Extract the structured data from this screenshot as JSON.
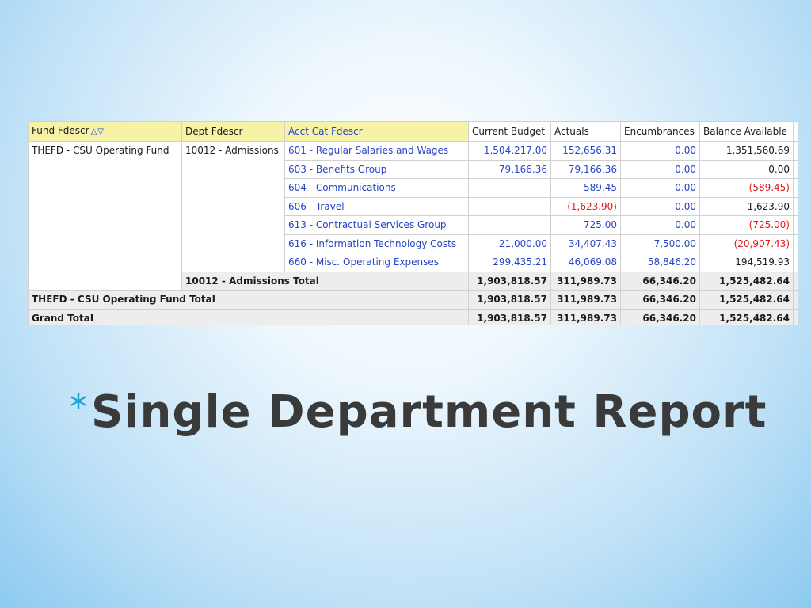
{
  "headers": {
    "fund": "Fund Fdescr",
    "dept": "Dept Fdescr",
    "acct": "Acct Cat Fdescr",
    "budget": "Current Budget",
    "actuals": "Actuals",
    "enc": "Encumbrances",
    "bal": "Balance Available"
  },
  "sort_icons": [
    "sort-ascending-icon",
    "sort-descending-icon"
  ],
  "fund_name": "THEFD - CSU Operating Fund",
  "dept_name": "10012 - Admissions",
  "rows": [
    {
      "acct": "601 - Regular Salaries and Wages",
      "budget": "1,504,217.00",
      "actuals": "152,656.31",
      "enc": "0.00",
      "bal": "1,351,560.69"
    },
    {
      "acct": "603 - Benefits Group",
      "budget": "79,166.36",
      "actuals": "79,166.36",
      "enc": "0.00",
      "bal": "0.00"
    },
    {
      "acct": "604 - Communications",
      "budget": "",
      "actuals": "589.45",
      "enc": "0.00",
      "bal": "(589.45)"
    },
    {
      "acct": "606 - Travel",
      "budget": "",
      "actuals": "(1,623.90)",
      "enc": "0.00",
      "bal": "1,623.90"
    },
    {
      "acct": "613 - Contractual Services Group",
      "budget": "",
      "actuals": "725.00",
      "enc": "0.00",
      "bal": "(725.00)"
    },
    {
      "acct": "616 - Information Technology Costs",
      "budget": "21,000.00",
      "actuals": "34,407.43",
      "enc": "7,500.00",
      "bal": "(20,907.43)"
    },
    {
      "acct": "660 - Misc. Operating Expenses",
      "budget": "299,435.21",
      "actuals": "46,069.08",
      "enc": "58,846.20",
      "bal": "194,519.93"
    }
  ],
  "dept_total": {
    "label": "10012 - Admissions Total",
    "budget": "1,903,818.57",
    "actuals": "311,989.73",
    "enc": "66,346.20",
    "bal": "1,525,482.64"
  },
  "fund_total": {
    "label": "THEFD - CSU Operating Fund Total",
    "budget": "1,903,818.57",
    "actuals": "311,989.73",
    "enc": "66,346.20",
    "bal": "1,525,482.64"
  },
  "grand_total": {
    "label": "Grand Total",
    "budget": "1,903,818.57",
    "actuals": "311,989.73",
    "enc": "66,346.20",
    "bal": "1,525,482.64"
  },
  "slide": {
    "bullet": "*",
    "title": "Single Department Report"
  },
  "colors": {
    "header_yellow": "#f7f3a6",
    "link_blue": "#2744c8",
    "negative_red": "#e01818",
    "total_gray": "#ededed",
    "bullet_blue": "#1aa3d6"
  }
}
